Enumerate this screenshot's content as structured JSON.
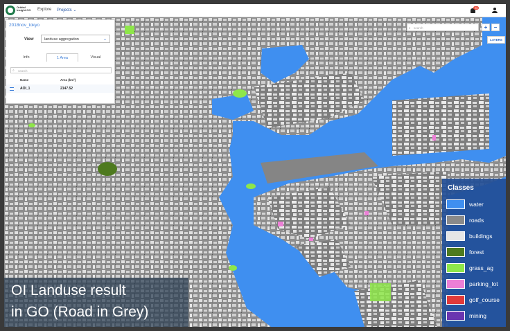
{
  "topbar": {
    "logo_text": "Orbital Insight GO",
    "nav_explore": "Explore",
    "nav_projects": "Projects",
    "notification_count": "20"
  },
  "panel": {
    "project_link": "2018nov_tokyo",
    "view_label": "View",
    "view_value": "landuse aggregation",
    "tabs": [
      {
        "label": "Info"
      },
      {
        "label": "1 Area"
      },
      {
        "label": "Visual"
      }
    ],
    "search_placeholder": "search",
    "columns": {
      "name": "Name",
      "area": "Area (km²)"
    },
    "rows": [
      {
        "name": "AOI_1",
        "area": "2147.52"
      }
    ]
  },
  "map_controls": {
    "search_placeholder": "search",
    "zoom_in": "+",
    "zoom_out": "−",
    "layers_label": "LAYERS"
  },
  "legend": {
    "title": "Classes",
    "items": [
      {
        "label": "water",
        "color": "#3f8ff0"
      },
      {
        "label": "roads",
        "color": "#8a8a8a"
      },
      {
        "label": "buildings",
        "color": "#e6e6e6"
      },
      {
        "label": "forest",
        "color": "#4e7a1f"
      },
      {
        "label": "grass_ag",
        "color": "#8ee64a"
      },
      {
        "label": "parking_lot",
        "color": "#ec7fd6"
      },
      {
        "label": "golf_course",
        "color": "#e03a3a"
      },
      {
        "label": "mining",
        "color": "#6a35b0"
      }
    ]
  },
  "caption": {
    "line1": "OI Landuse result",
    "line2": "in GO (Road in Grey)"
  }
}
